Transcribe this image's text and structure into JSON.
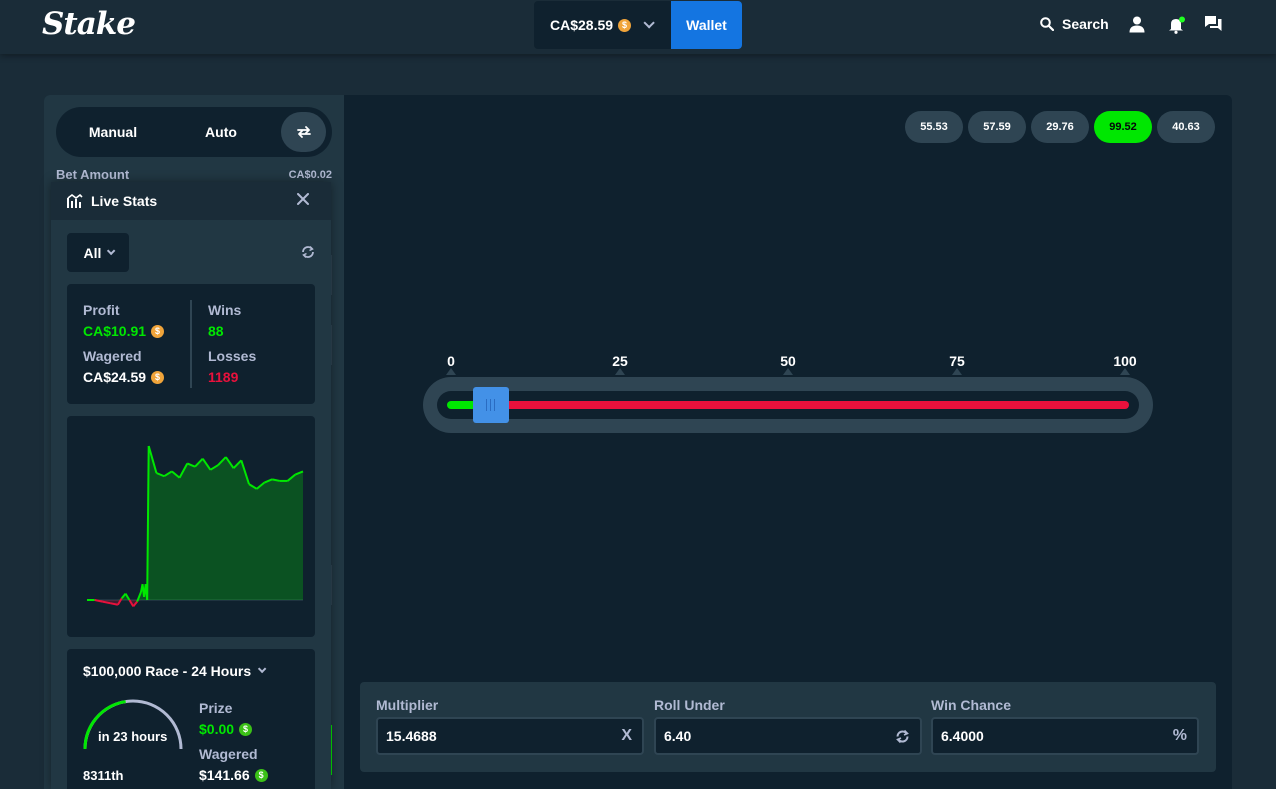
{
  "header": {
    "logo": "Stake",
    "balance": "CA$28.59",
    "balance_currency_icon": "dollar-coin-icon",
    "wallet_label": "Wallet",
    "search_label": "Search",
    "icons": [
      "search-icon",
      "user-icon",
      "bell-icon",
      "chat-icon"
    ],
    "notification_dot_color": "#1fff20"
  },
  "sidebar": {
    "tabs": [
      {
        "label": "Manual"
      },
      {
        "label": "Auto"
      }
    ],
    "swap_icon": "swap-icon",
    "bet_amount_label": "Bet Amount",
    "bet_amount_value": "CA$0.02"
  },
  "live_stats": {
    "title": "Live Stats",
    "filter": "All",
    "profit_label": "Profit",
    "profit_value": "CA$10.91",
    "wins_label": "Wins",
    "wins_value": "88",
    "wagered_label": "Wagered",
    "wagered_value": "CA$24.59",
    "losses_label": "Losses",
    "losses_value": "1189",
    "colors": {
      "profit": "#00e701",
      "loss": "#e9113c"
    },
    "chart_data": {
      "type": "area",
      "x": [
        0,
        10,
        20,
        30,
        40,
        45,
        50,
        55,
        60,
        65,
        70,
        72,
        74,
        76,
        78,
        80,
        90,
        100,
        110,
        120,
        130,
        140,
        150,
        160,
        170,
        180,
        190,
        200,
        210,
        220,
        230,
        240,
        250,
        260,
        270,
        280
      ],
      "values": [
        0,
        0,
        -0.1,
        -0.2,
        -0.3,
        0.1,
        0.4,
        0,
        -0.4,
        -0.1,
        0.5,
        1.0,
        0.2,
        1.0,
        0,
        9.7,
        8.0,
        7.8,
        8.1,
        7.7,
        8.6,
        8.4,
        8.9,
        8.2,
        8.5,
        9.0,
        8.3,
        8.8,
        7.3,
        7.0,
        7.4,
        7.6,
        7.5,
        7.5,
        7.9,
        8.1
      ],
      "baseline": 0
    }
  },
  "race": {
    "title": "$100,000 Race - 24 Hours",
    "time_left": "in 23 hours",
    "rank": "8311th",
    "prize_label": "Prize",
    "prize_value": "$0.00",
    "wagered_label": "Wagered",
    "wagered_value": "$141.66",
    "progress": 0.45
  },
  "history": [
    "55.53",
    "57.59",
    "29.76",
    "99.52",
    "40.63"
  ],
  "dice": {
    "scale": [
      "0",
      "25",
      "50",
      "75",
      "100"
    ],
    "roll_under": 6.4
  },
  "fields": {
    "multiplier_label": "Multiplier",
    "multiplier_value": "15.4688",
    "multiplier_suffix": "X",
    "roll_under_label": "Roll Under",
    "roll_under_value": "6.40",
    "win_chance_label": "Win Chance",
    "win_chance_value": "6.4000",
    "win_chance_suffix": "%"
  }
}
